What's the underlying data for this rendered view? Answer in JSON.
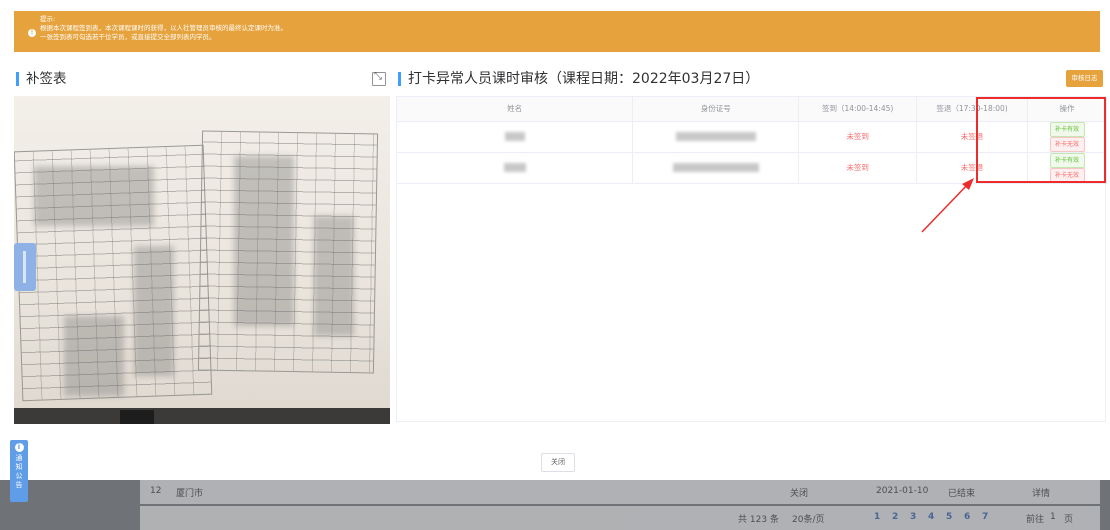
{
  "background": {
    "row": {
      "index": "12",
      "city": "厦门市",
      "btn_a": "关闭",
      "date": "2021-01-10",
      "status": "已结束",
      "action": "详情"
    },
    "pager": {
      "total": "共 123 条",
      "page_size": "20条/页",
      "pages": [
        "1",
        "2",
        "3",
        "4",
        "5",
        "6",
        "7"
      ],
      "goto_label": "前往",
      "goto_value": "1",
      "page_suffix": "页"
    }
  },
  "alert": {
    "title": "提示:",
    "line1": "根据本次课程签到表，本次课程课时的获得，以人社管理员审核的最终认定课时为准。",
    "line2": "一张签到表可勾选若干位学员，或直接提交全部列表内学员。"
  },
  "left_panel": {
    "title": "补签表"
  },
  "right_panel": {
    "title": "打卡异常人员课时审核（课程日期：2022年03月27日）",
    "audit_log_label": "审核日志",
    "columns": [
      "姓名",
      "身份证号",
      "签到（14:00-14:45)",
      "签退（17:30-18:00)",
      "操作"
    ],
    "rows": [
      {
        "sign_in": "未签到",
        "sign_out": "未签退",
        "valid_label": "补卡有效",
        "invalid_label": "补卡无效"
      },
      {
        "sign_in": "未签到",
        "sign_out": "未签退",
        "valid_label": "补卡有效",
        "invalid_label": "补卡无效"
      }
    ]
  },
  "close_label": "关闭",
  "notice_tab": {
    "chars": [
      "通",
      "知",
      "公",
      "告"
    ]
  },
  "colors": {
    "warning": "#e6a23c",
    "primary": "#409eff",
    "danger": "#f56c6c",
    "success": "#67c23a",
    "highlight": "#ee2a2a"
  }
}
